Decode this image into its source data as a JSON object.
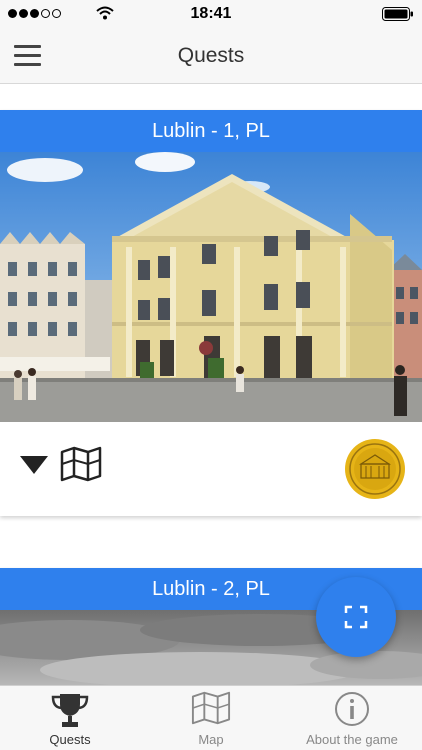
{
  "status_bar": {
    "time": "18:41",
    "signal_dots_filled": 3,
    "signal_dots_total": 5,
    "icons": [
      "signal-icon",
      "wifi-icon",
      "battery-icon"
    ]
  },
  "nav": {
    "title": "Quests",
    "menu_icon": "hamburger-menu-icon"
  },
  "quests": [
    {
      "title": "Lublin - 1, PL",
      "photo": "town-hall-photo",
      "medal_icon": "gold-medal-icon"
    },
    {
      "title": "Lublin - 2, PL",
      "photo": "cloudy-sky-photo"
    }
  ],
  "fab": {
    "icon": "scan-frame-icon"
  },
  "tabs": [
    {
      "label": "Quests",
      "icon": "trophy-icon",
      "active": true
    },
    {
      "label": "Map",
      "icon": "map-icon",
      "active": false
    },
    {
      "label": "About the game",
      "icon": "info-icon",
      "active": false
    }
  ],
  "colors": {
    "accent": "#2f80ed",
    "bar_background": "#f7f7f7",
    "medal_gold": "#e6b417"
  }
}
